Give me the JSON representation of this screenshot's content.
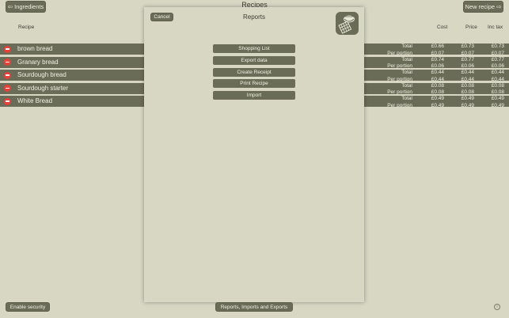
{
  "header": {
    "title": "Recipes",
    "ingredients_button": "⇦ Ingredients",
    "new_recipe_button": "New recipe ⇨"
  },
  "table": {
    "columns": {
      "recipe": "Recipe",
      "cost": "Cost",
      "price": "Price",
      "inc_tax": "Inc tax"
    },
    "rows": [
      {
        "name": "brown bread",
        "total_label": "Total",
        "per_portion_label": "Per portion",
        "total": {
          "cost": "£0.66",
          "price": "£0.73",
          "inc_tax": "£0.73"
        },
        "per_portion": {
          "cost": "£0.07",
          "price": "£0.07",
          "inc_tax": "£0.07"
        }
      },
      {
        "name": "Granary bread",
        "total_label": "Total",
        "per_portion_label": "Per portion",
        "total": {
          "cost": "£0.74",
          "price": "£0.77",
          "inc_tax": "£0.77"
        },
        "per_portion": {
          "cost": "£0.06",
          "price": "£0.06",
          "inc_tax": "£0.06"
        }
      },
      {
        "name": "Sourdough bread",
        "total_label": "Total",
        "per_portion_label": "Per portion",
        "total": {
          "cost": "£0.44",
          "price": "£0.44",
          "inc_tax": "£0.44"
        },
        "per_portion": {
          "cost": "£0.44",
          "price": "£0.44",
          "inc_tax": "£0.44"
        }
      },
      {
        "name": "Sourdough starter",
        "total_label": "Total",
        "per_portion_label": "Per portion",
        "total": {
          "cost": "£0.08",
          "price": "£0.08",
          "inc_tax": "£0.08"
        },
        "per_portion": {
          "cost": "£0.08",
          "price": "£0.08",
          "inc_tax": "£0.08"
        }
      },
      {
        "name": "White Bread",
        "total_label": "Total",
        "per_portion_label": "Per portion",
        "total": {
          "cost": "£0.49",
          "price": "£0.49",
          "inc_tax": "£0.49"
        },
        "per_portion": {
          "cost": "£0.49",
          "price": "£0.49",
          "inc_tax": "£0.49"
        }
      }
    ]
  },
  "modal": {
    "title": "Reports",
    "cancel_button": "Cancel",
    "buttons": [
      "Shopping List",
      "Export data",
      "Create Receipt",
      "Print Recipe",
      "Import"
    ]
  },
  "footer": {
    "enable_security_button": "Enable security",
    "reports_button": "Reports, Imports and Exports",
    "info_glyph": "i"
  },
  "colors": {
    "background": "#d8d7c4",
    "row": "#6b6c58",
    "delete": "#e6413a",
    "text_light": "#f2f1e4"
  }
}
